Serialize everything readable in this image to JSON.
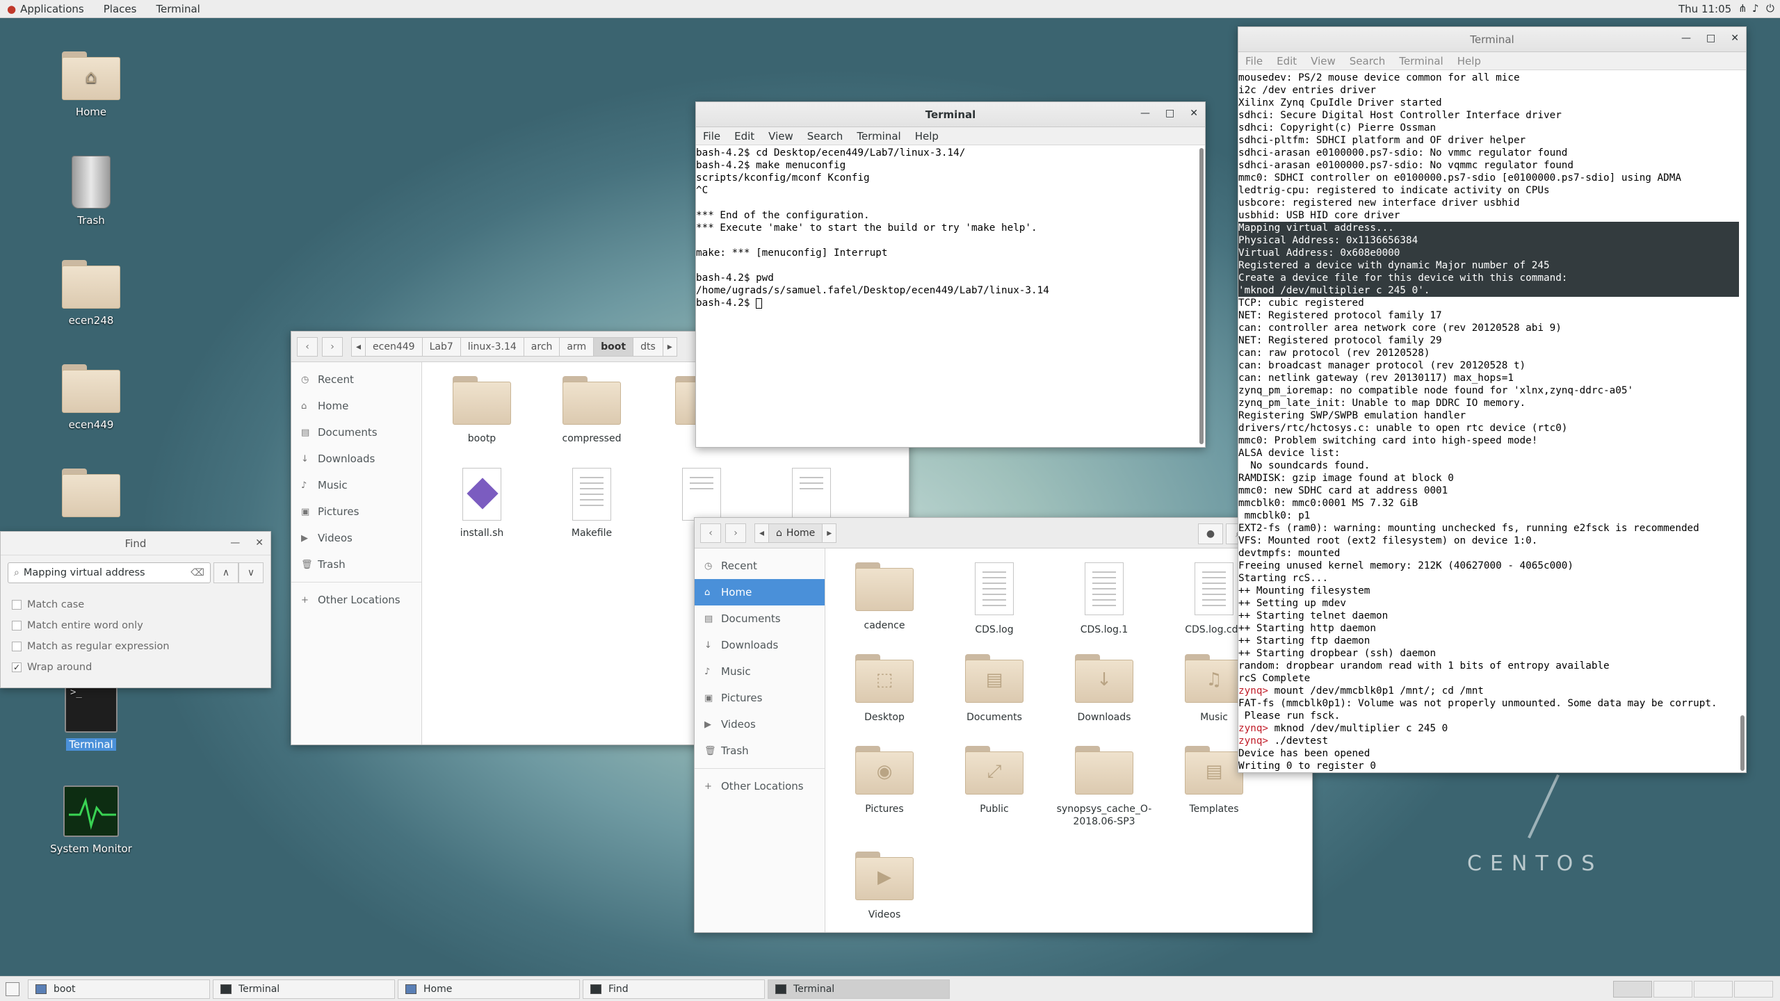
{
  "topbar": {
    "applications": "Applications",
    "places": "Places",
    "terminal": "Terminal",
    "clock": "Thu 11:05"
  },
  "desktop": {
    "icons": [
      {
        "label": "Home"
      },
      {
        "label": "Trash"
      },
      {
        "label": "ecen248"
      },
      {
        "label": "ecen449"
      },
      {
        "label": "Terminal"
      },
      {
        "label": "System Monitor"
      }
    ]
  },
  "watermark": "CENTOS",
  "term_right": {
    "title": "Terminal",
    "menu": [
      "File",
      "Edit",
      "View",
      "Search",
      "Terminal",
      "Help"
    ],
    "lines": [
      "mousedev: PS/2 mouse device common for all mice",
      "i2c /dev entries driver",
      "Xilinx Zynq CpuIdle Driver started",
      "sdhci: Secure Digital Host Controller Interface driver",
      "sdhci: Copyright(c) Pierre Ossman",
      "sdhci-pltfm: SDHCI platform and OF driver helper",
      "sdhci-arasan e0100000.ps7-sdio: No vmmc regulator found",
      "sdhci-arasan e0100000.ps7-sdio: No vqmmc regulator found",
      "mmc0: SDHCI controller on e0100000.ps7-sdio [e0100000.ps7-sdio] using ADMA",
      "ledtrig-cpu: registered to indicate activity on CPUs",
      "usbcore: registered new interface driver usbhid",
      "usbhid: USB HID core driver"
    ],
    "selected": [
      "Mapping virtual address...",
      "Physical Address: 0x1136656384",
      "Virtual Address: 0x608e0000",
      "Registered a device with dynamic Major number of 245",
      "Create a device file for this device with this command:",
      "'mknod /dev/multiplier c 245 0'."
    ],
    "lines2": [
      "TCP: cubic registered",
      "NET: Registered protocol family 17",
      "can: controller area network core (rev 20120528 abi 9)",
      "NET: Registered protocol family 29",
      "can: raw protocol (rev 20120528)",
      "can: broadcast manager protocol (rev 20120528 t)",
      "can: netlink gateway (rev 20130117) max_hops=1",
      "zynq_pm_ioremap: no compatible node found for 'xlnx,zynq-ddrc-a05'",
      "zynq_pm_late_init: Unable to map DDRC IO memory.",
      "Registering SWP/SWPB emulation handler",
      "drivers/rtc/hctosys.c: unable to open rtc device (rtc0)",
      "mmc0: Problem switching card into high-speed mode!",
      "ALSA device list:",
      "  No soundcards found.",
      "RAMDISK: gzip image found at block 0",
      "mmc0: new SDHC card at address 0001",
      "mmcblk0: mmc0:0001 MS 7.32 GiB",
      " mmcblk0: p1",
      "EXT2-fs (ram0): warning: mounting unchecked fs, running e2fsck is recommended",
      "VFS: Mounted root (ext2 filesystem) on device 1:0.",
      "devtmpfs: mounted",
      "Freeing unused kernel memory: 212K (40627000 - 4065c000)",
      "Starting rcS...",
      "++ Mounting filesystem",
      "++ Setting up mdev",
      "++ Starting telnet daemon",
      "++ Starting http daemon",
      "++ Starting ftp daemon",
      "++ Starting dropbear (ssh) daemon",
      "random: dropbear urandom read with 1 bits of entropy available",
      "rcS Complete"
    ],
    "prompt": "zynq>",
    "cmd1": " mount /dev/mmcblk0p1 /mnt/; cd /mnt",
    "fat1": "FAT-fs (mmcblk0p1): Volume was not properly unmounted. Some data may be corrupt.",
    "fat2": " Please run fsck.",
    "cmd2": " mknod /dev/multiplier c 245 0",
    "cmd3": " ./devtest",
    "out1": "Device has been opened",
    "out2": "Writing 0 to register 0"
  },
  "term_center": {
    "title": "Terminal",
    "menu": [
      "File",
      "Edit",
      "View",
      "Search",
      "Terminal",
      "Help"
    ],
    "lines": [
      "bash-4.2$ cd Desktop/ecen449/Lab7/linux-3.14/",
      "bash-4.2$ make menuconfig",
      "scripts/kconfig/mconf Kconfig",
      "^C",
      "",
      "*** End of the configuration.",
      "*** Execute 'make' to start the build or try 'make help'.",
      "",
      "make: *** [menuconfig] Interrupt",
      "",
      "bash-4.2$ pwd",
      "/home/ugrads/s/samuel.fafel/Desktop/ecen449/Lab7/linux-3.14",
      "bash-4.2$ "
    ]
  },
  "files_boot": {
    "crumbs": [
      "ecen449",
      "Lab7",
      "linux-3.14",
      "arch",
      "arm",
      "boot",
      "dts"
    ],
    "sidebar": [
      "Recent",
      "Home",
      "Documents",
      "Downloads",
      "Music",
      "Pictures",
      "Videos",
      "Trash"
    ],
    "other": "Other Locations",
    "items": [
      "bootp",
      "compressed",
      "install.sh",
      "Makefile"
    ]
  },
  "files_home": {
    "crumb": "Home",
    "sidebar": [
      "Recent",
      "Home",
      "Documents",
      "Downloads",
      "Music",
      "Pictures",
      "Videos",
      "Trash"
    ],
    "other": "Other Locations",
    "items": [
      "cadence",
      "CDS.log",
      "CDS.log.1",
      "CDS.log.cds",
      "Desktop",
      "Documents",
      "Downloads",
      "Music",
      "Pictures",
      "Public",
      "synopsys_cache_O-2018.06-SP3",
      "Templates",
      "Videos"
    ]
  },
  "find": {
    "title": "Find",
    "query": "Mapping virtual address",
    "options": [
      "Match case",
      "Match entire word only",
      "Match as regular expression",
      "Wrap around"
    ],
    "checked": [
      false,
      false,
      false,
      true
    ]
  },
  "taskbar": [
    "boot",
    "Terminal",
    "Home",
    "Find",
    "Terminal"
  ]
}
